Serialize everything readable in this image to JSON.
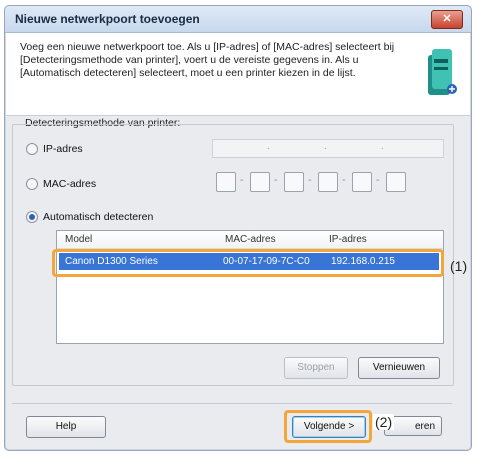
{
  "window": {
    "title": "Nieuwe netwerkpoort toevoegen",
    "close_glyph": "✕",
    "intro": "Voeg een nieuwe netwerkpoort toe. Als u [IP-adres] of [MAC-adres] selecteert bij [Detecteringsmethode van printer], voert u de vereiste gegevens in. Als u [Automatisch detecteren] selecteert, moet u een printer kiezen in de lijst."
  },
  "detection": {
    "group_label": "Detecteringsmethode van printer:",
    "options": [
      "IP-adres",
      "MAC-adres",
      "Automatisch detecteren"
    ],
    "selected": "Automatisch detecteren",
    "ip_separator": ".",
    "mac_separator": "-"
  },
  "printer_list": {
    "columns": [
      "Model",
      "MAC-adres",
      "IP-adres"
    ],
    "rows": [
      {
        "model": "Canon D1300 Series",
        "mac": "00-07-17-09-7C-C0",
        "ip": "192.168.0.215"
      }
    ]
  },
  "buttons": {
    "stop": "Stoppen",
    "refresh": "Vernieuwen",
    "help": "Help",
    "next": "Volgende >",
    "cancel_partial": "eren"
  },
  "callouts": {
    "row": "(1)",
    "next": "(2)"
  },
  "colors": {
    "selection": "#3875d7",
    "highlight": "#f3a73a",
    "title_bg": "#c7d8ee"
  },
  "icons": {
    "header": "printer-network-icon"
  }
}
